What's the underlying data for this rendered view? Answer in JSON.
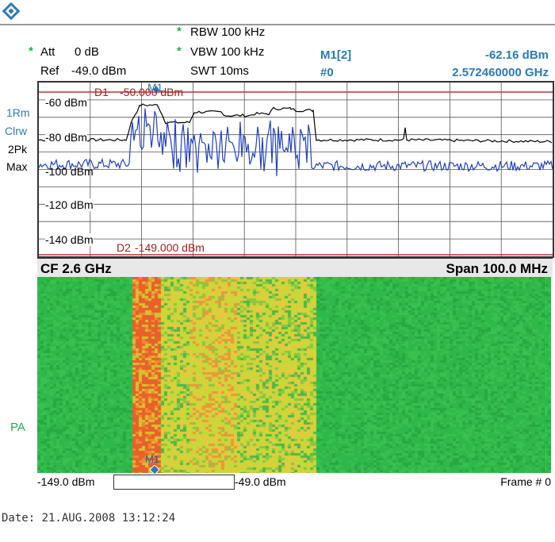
{
  "header": {
    "att_label": "Att",
    "att_value": "0 dB",
    "ref_label": "Ref",
    "ref_value": "-49.0 dBm",
    "rbw": "RBW 100 kHz",
    "vbw": "VBW 100 kHz",
    "swt": "SWT 10ms",
    "marker_name": "M1[2]",
    "marker_trace": "#0",
    "marker_level": "-62.16 dBm",
    "marker_freq": "2.572460000 GHz",
    "star": "*"
  },
  "traces": {
    "t1": "1Rm",
    "t2": "Clrw",
    "t3": "2Pk",
    "t4": "Max"
  },
  "spectrum": {
    "y_ticks": [
      "-60 dBm",
      "-80 dBm",
      "-100 dBm",
      "-120 dBm",
      "-140 dBm"
    ],
    "d1_label": "D1",
    "d1_value": "-50.000 dBm",
    "d2_label": "D2",
    "d2_value": "-149.000 dBm",
    "marker_label": "M1"
  },
  "center": {
    "cf": "CF 2.6 GHz",
    "span": "Span 100.0 MHz"
  },
  "waterfall": {
    "pa_label": "PA",
    "marker_label": "M1",
    "scale_min": "-149.0 dBm",
    "scale_max": "-49.0 dBm",
    "frame": "Frame # 0"
  },
  "date": "Date: 21.AUG.2008  13:12:24",
  "colors": {
    "trace_blue": "#2040c0",
    "trace_black": "#000000",
    "display_line": "#c03030",
    "marker_blue": "#2a7ab8",
    "star_green": "#20b050",
    "waterfall_base": "#2fb84a"
  }
}
